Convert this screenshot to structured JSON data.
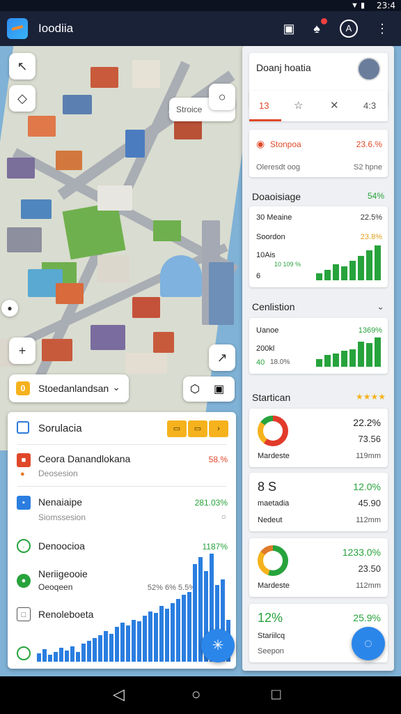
{
  "status": {
    "time": "23:4"
  },
  "appbar": {
    "title": "Ioodiia"
  },
  "map": {
    "search_placeholder": "Stroice"
  },
  "selector": {
    "icon": "0",
    "label": "Stoedanlandsan"
  },
  "left_panel": {
    "title": "Sorulacia",
    "rows": [
      {
        "name": "Ceora Danandlokana",
        "sub": "Deosesion",
        "value": "58.%"
      },
      {
        "name": "Nenaiaipe",
        "sub": "Siomssesion",
        "value": "281.03%"
      },
      {
        "name": "Denoocioa",
        "sub": "",
        "value": "1187%"
      },
      {
        "name": "Neriigeooie",
        "sub": "Oeoqeen",
        "value": "52% 6% 5.5%"
      },
      {
        "name": "Renoleboeta",
        "sub": "",
        "value": ""
      }
    ],
    "bars": [
      12,
      18,
      10,
      14,
      20,
      16,
      22,
      14,
      26,
      30,
      34,
      38,
      44,
      40,
      50,
      56,
      52,
      60,
      58,
      66,
      72,
      70,
      80,
      76,
      84,
      90,
      96,
      100,
      140,
      150,
      130,
      155,
      110,
      118,
      60
    ]
  },
  "right_panel": {
    "profile_name": "Doanj hoatia",
    "tabs": [
      "13",
      "☆",
      "✕",
      "4:3"
    ],
    "alert": {
      "title": "Stonpoa",
      "value": "23.6.%",
      "sub": "Oleresdt oog",
      "sub_value": "S2 hpne"
    },
    "sections": {
      "s1": {
        "title": "Doaoisiage",
        "value": "54%",
        "rows": [
          {
            "label": "30 Meaine",
            "value": "22.5%"
          },
          {
            "label": "Soordon",
            "value": "23.8%"
          },
          {
            "label": "10Ais",
            "value": "10 109 %"
          },
          {
            "label": "6",
            "value": ""
          }
        ],
        "bars": [
          20,
          30,
          45,
          40,
          55,
          70,
          85,
          100
        ]
      },
      "s2": {
        "title": "Cenlistion",
        "rows": [
          {
            "label": "Uanoe",
            "value": "1369%"
          },
          {
            "label": "200kl",
            "value": ""
          },
          {
            "label": "40",
            "value": "18.0%"
          }
        ],
        "bars": [
          25,
          40,
          45,
          55,
          60,
          85,
          80,
          100
        ]
      },
      "s3": {
        "title": "Startican",
        "stars": "★★★★",
        "cards": [
          {
            "top": "22.2%",
            "mid": "73.56",
            "label": "Mardeste",
            "foot": "119mm"
          },
          {
            "top": "12.0%",
            "mid": "45.90",
            "label": "Nedeut",
            "foot": "112mm",
            "head": "8 S",
            "sub": "maetadia"
          },
          {
            "top": "1233.0%",
            "mid": "23.50",
            "label": "Mardeste",
            "foot": "112mm"
          },
          {
            "top": "25.9%",
            "mid": "12%",
            "label": "Seepon",
            "sub": "Stariilcq"
          }
        ]
      }
    }
  },
  "colors": {
    "accent_green": "#27a33c",
    "accent_blue": "#2b7ee0",
    "accent_orange": "#f04c1f",
    "accent_yellow": "#f5b21d"
  }
}
